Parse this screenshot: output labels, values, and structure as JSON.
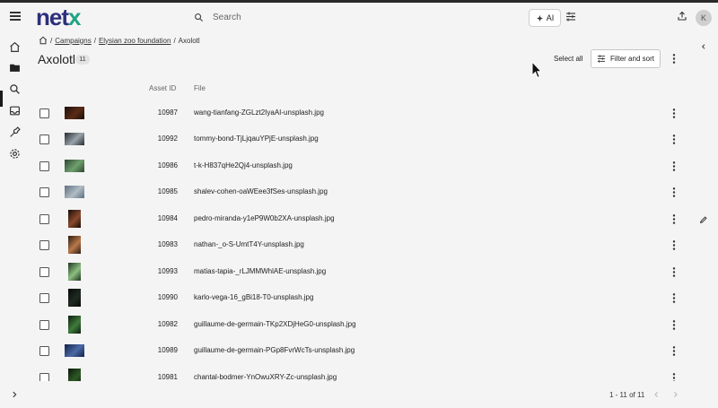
{
  "app": {
    "logo_part1": "net",
    "logo_part2": "x"
  },
  "search": {
    "placeholder": "Search"
  },
  "toolbar": {
    "ai_label": "AI"
  },
  "user": {
    "avatar_initial": "K"
  },
  "breadcrumb": {
    "items": [
      "Campaigns",
      "Elysian zoo foundation"
    ],
    "current": "Axolotl"
  },
  "page": {
    "title": "Axolotl",
    "count": "11"
  },
  "actions": {
    "select_all": "Select all",
    "filter_sort": "Filter and sort"
  },
  "table": {
    "columns": [
      "Asset ID",
      "File"
    ],
    "rows": [
      {
        "id": "10987",
        "file": "wang-tianfang-ZGLzt2IyaAI-unsplash.jpg",
        "thumb": "landscape",
        "colors": [
          "#1b0f0a",
          "#5a2b16"
        ]
      },
      {
        "id": "10992",
        "file": "tommy-bond-TjLjqauYPjE-unsplash.jpg",
        "thumb": "landscape",
        "colors": [
          "#272b30",
          "#9aa3ab"
        ]
      },
      {
        "id": "10986",
        "file": "t-k-H837qHe2Qj4-unsplash.jpg",
        "thumb": "landscape",
        "colors": [
          "#2e4630",
          "#6fa06e"
        ]
      },
      {
        "id": "10985",
        "file": "shalev-cohen-oaWEee3fSes-unsplash.jpg",
        "thumb": "landscape",
        "colors": [
          "#5f6f7d",
          "#b0bcc6"
        ]
      },
      {
        "id": "10984",
        "file": "pedro-miranda-y1eP9W0b2XA-unsplash.jpg",
        "thumb": "portrait",
        "colors": [
          "#170c08",
          "#8a4a2e"
        ]
      },
      {
        "id": "10983",
        "file": "nathan-_o-S-UmtT4Y-unsplash.jpg",
        "thumb": "portrait",
        "colors": [
          "#2c1b11",
          "#b8794a"
        ]
      },
      {
        "id": "10993",
        "file": "matias-tapia-_rLJMMWhlAE-unsplash.jpg",
        "thumb": "portrait",
        "colors": [
          "#1e3520",
          "#8dbf80"
        ]
      },
      {
        "id": "10990",
        "file": "karlo-vega-16_gBi18-T0-unsplash.jpg",
        "thumb": "portrait",
        "colors": [
          "#080a08",
          "#1f2a22"
        ]
      },
      {
        "id": "10982",
        "file": "guillaume-de-germain-TKp2XDjHeG0-unsplash.jpg",
        "thumb": "portrait",
        "colors": [
          "#0f1d10",
          "#3e7c3c"
        ]
      },
      {
        "id": "10989",
        "file": "guillaume-de-germain-PGp8FvrWcTs-unsplash.jpg",
        "thumb": "landscape",
        "colors": [
          "#10224a",
          "#4d6aa6"
        ]
      },
      {
        "id": "10981",
        "file": "chantal-bodmer-YnOwuXRY-Zc-unsplash.jpg",
        "thumb": "portrait",
        "colors": [
          "#0c160b",
          "#2d5a25"
        ]
      }
    ]
  },
  "pagination": {
    "range": "1 - 11 of 11"
  }
}
